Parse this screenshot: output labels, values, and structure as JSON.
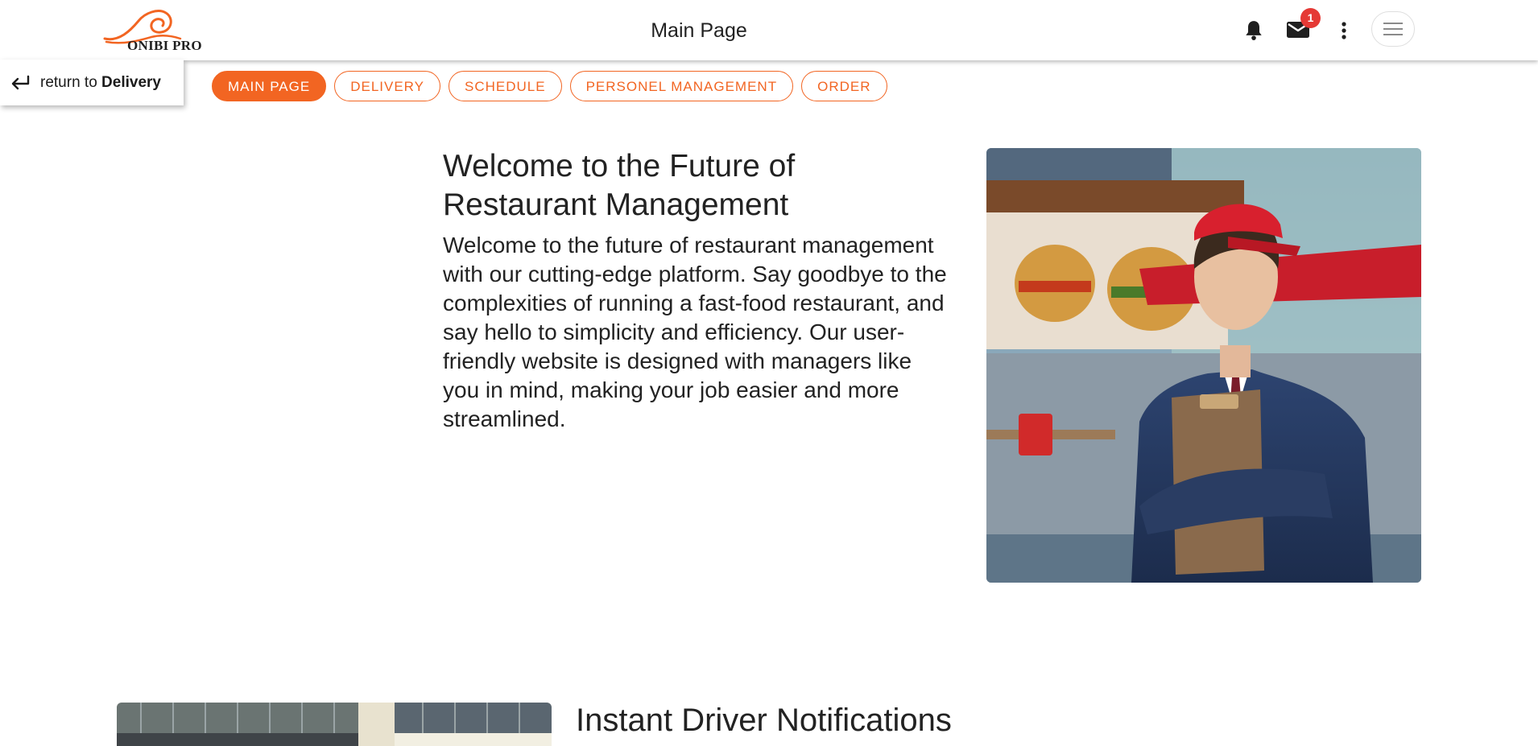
{
  "brand": {
    "logo_text": "ONIBI PRO",
    "accent_color": "#f26522"
  },
  "header": {
    "title": "Main Page",
    "notifications_icon": "bell-icon",
    "mail_icon": "mail-icon",
    "mail_badge": "1",
    "more_icon": "more-vert-icon",
    "menu_icon": "hamburger-menu-icon"
  },
  "return_link": {
    "prefix": "return to ",
    "target": "Delivery"
  },
  "tabs": [
    {
      "label": "MAIN PAGE",
      "active": true
    },
    {
      "label": "DELIVERY",
      "active": false
    },
    {
      "label": "SCHEDULE",
      "active": false
    },
    {
      "label": "PERSONEL MANAGEMENT",
      "active": false
    },
    {
      "label": "ORDER",
      "active": false
    }
  ],
  "hero": {
    "title": "Welcome to the Future of Restaurant Management",
    "text": "Welcome to the future of restaurant management with our cutting-edge platform. Say goodbye to the complexities of running a fast-food restaurant, and say hello to simplicity and efficiency. Our user-friendly website is designed with managers like you in mind, making your job easier and more streamlined."
  },
  "section2": {
    "title": "Instant Driver Notifications"
  }
}
